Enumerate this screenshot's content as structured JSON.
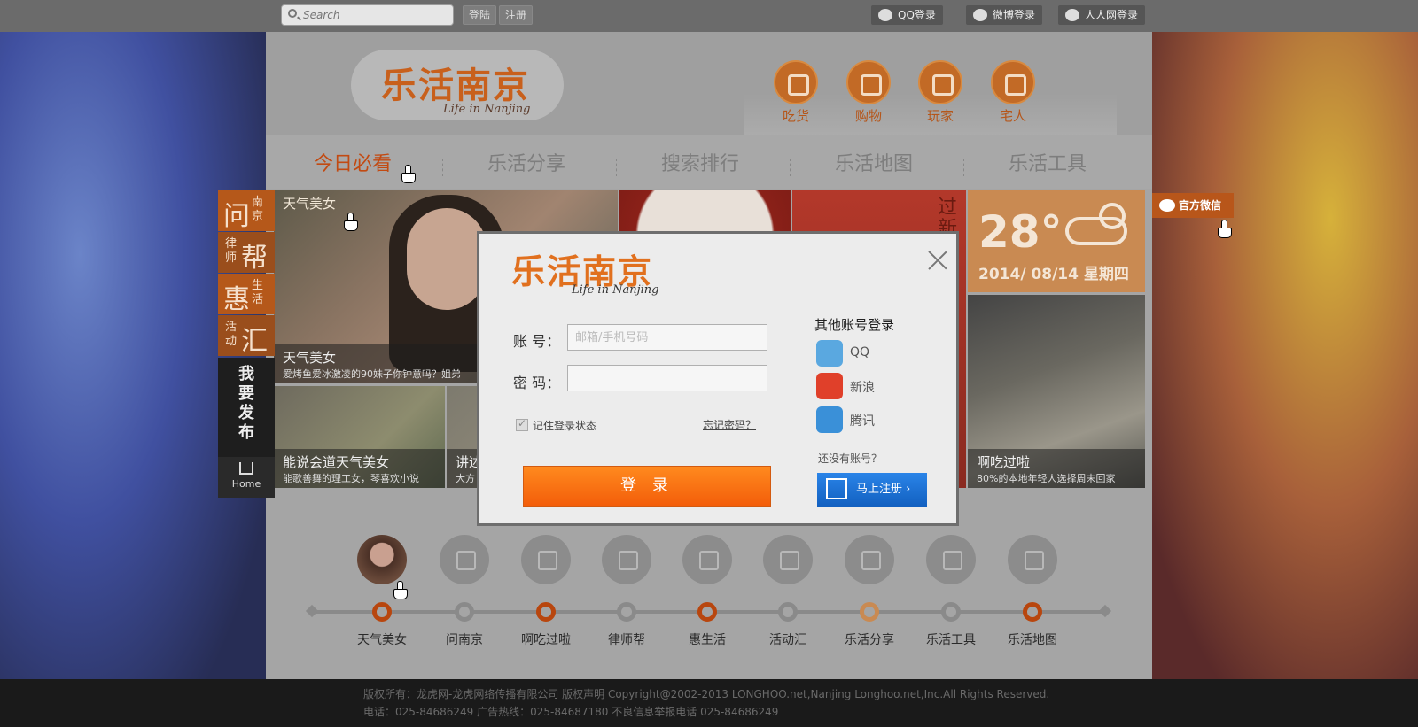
{
  "topbar": {
    "search_placeholder": "Search",
    "login": "登陆",
    "register": "注册",
    "qq_login": "QQ登录",
    "weibo_login": "微博登录",
    "renren_login": "人人网登录"
  },
  "header": {
    "logo": "乐活南京",
    "logo_sub": "Life in Nanjing",
    "categories": [
      "吃货",
      "购物",
      "玩家",
      "宅人"
    ]
  },
  "nav": {
    "items": [
      "今日必看",
      "乐活分享",
      "搜索排行",
      "乐活地图",
      "乐活工具"
    ]
  },
  "sidemenu": {
    "items": [
      {
        "big": "问",
        "small": "南京"
      },
      {
        "big": "帮",
        "small": "律师"
      },
      {
        "big": "惠",
        "small": "生活"
      },
      {
        "big": "汇",
        "small": "活动"
      }
    ],
    "publish": "我要发布",
    "home": "Home"
  },
  "tiles": {
    "big_tag": "天气美女",
    "big_title": "天气美女",
    "big_sub": "爱烤鱼爱冰激凌的90妹子你钟意吗？姐弟",
    "s1_title": "能说会道天气美女",
    "s1_sub": "能歌善舞的理工女，琴喜欢小说",
    "s2_title": "讲述",
    "s2_sub": "大方",
    "red_text": "过新 跟着",
    "weather_temp": "28°",
    "weather_date": "2014/ 08/14 星期四",
    "alley_title": "啊吃过啦",
    "alley_sub": "80%的本地年轻人选择周末回家"
  },
  "wechat": "官方微信",
  "timeline": {
    "items": [
      "天气美女",
      "问南京",
      "啊吃过啦",
      "律师帮",
      "惠生活",
      "活动汇",
      "乐活分享",
      "乐活工具",
      "乐活地图"
    ]
  },
  "footer": {
    "line1": "版权所有：龙虎网-龙虎网络传播有限公司 版权声明 Copyright@2002-2013 LONGHOO.net,Nanjing Longhoo.net,Inc.All Rights Reserved.",
    "line2": "电话：025-84686249 广告热线：025-84687180 不良信息举报电话 025-84686249"
  },
  "modal": {
    "logo": "乐活南京",
    "logo_sub": "Life in Nanjing",
    "account_label": "账 号：",
    "account_placeholder": "邮箱/手机号码",
    "password_label": "密 码：",
    "remember": "记住登录状态",
    "forgot": "忘记密码？",
    "login_button": "登 录",
    "other_title": "其他账号登录",
    "other_accounts": [
      "QQ",
      "新浪",
      "腾讯"
    ],
    "no_account": "还没有账号？",
    "register_button": "马上注册 ›"
  },
  "colors": {
    "brand_orange": "#f36c10",
    "register_blue": "#1a6fd6"
  }
}
